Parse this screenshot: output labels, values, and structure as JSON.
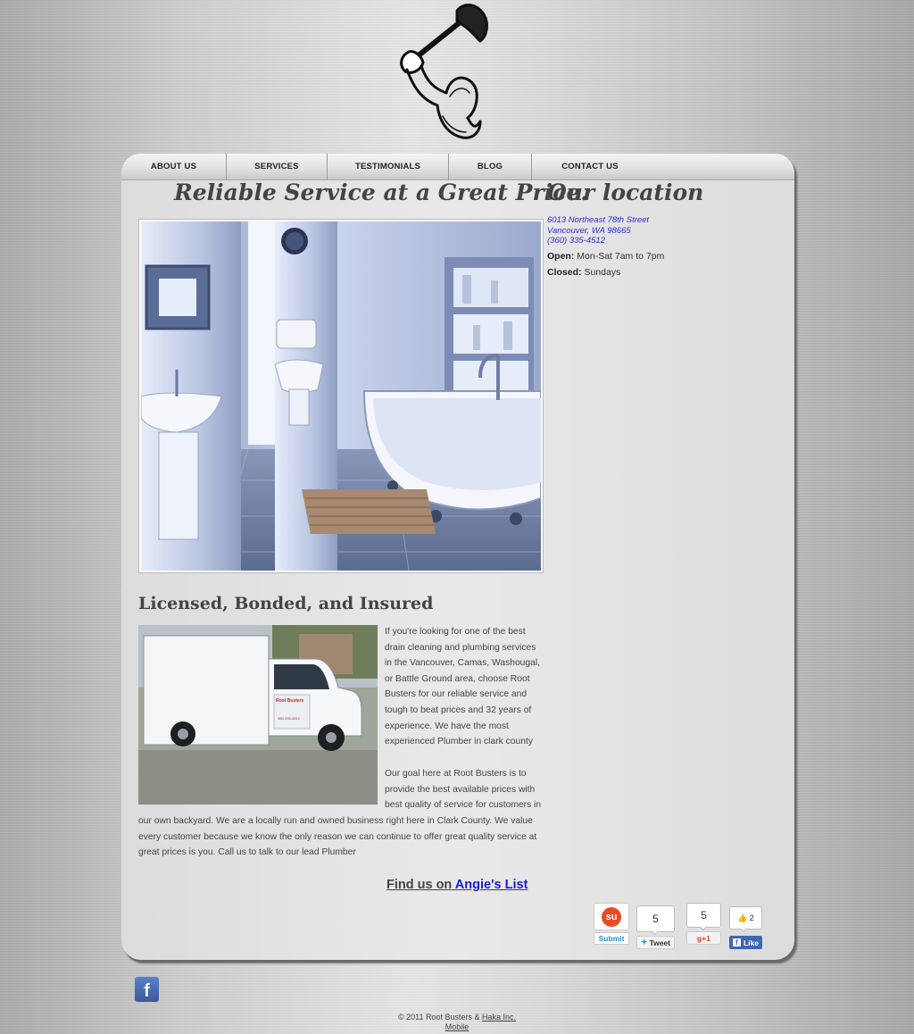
{
  "nav": {
    "items": [
      {
        "label": "ABOUT US"
      },
      {
        "label": "SERVICES"
      },
      {
        "label": "TESTIMONIALS"
      },
      {
        "label": "BLOG"
      },
      {
        "label": "CONTACT US"
      }
    ]
  },
  "main": {
    "heading": "Reliable Service at a Great Price.",
    "subheading": "Licensed, Bonded, and Insured",
    "paragraph1": "If you're looking for one of the best drain cleaning and plumbing services in the Vancouver, Camas, Washougal, or Battle Ground area, choose Root Busters for our reliable service and tough to beat prices and 32 years of experience. We have the most experienced Plumber in clark county",
    "paragraph2_part1": "Our goal here at Root Busters is to provide the best available prices with best quality of service for customers in",
    "paragraph2_part2": "our own backyard. We are a locally run and owned business right here in Clark County. We value every customer because we know the only reason we can continue to offer great quality service at great prices is you. Call us to talk to our lead Plumber",
    "find_us_prefix": "Find us on",
    "find_us_link": "Angie's List",
    "truck_text": {
      "line1": "Root Busters",
      "line2": "360-335-4512"
    }
  },
  "location": {
    "heading": "Our location",
    "street": "6013 Northeast 78th Street",
    "city": "Vancouver, WA 98665",
    "phone": "(360) 335-4512",
    "open_label": "Open:",
    "open_value": "Mon-Sat 7am to 7pm",
    "closed_label": "Closed:",
    "closed_value": "Sundays"
  },
  "social": {
    "stumble_label": "Submit",
    "tweet_count": "5",
    "tweet_label": "Tweet",
    "gplus_count": "5",
    "gplus_label": "g+1",
    "fb_count": "2",
    "fb_label": "Like"
  },
  "footer": {
    "copyright": "© 2011 Root Busters &",
    "credit_link": "Haka Inc.",
    "mobile_link": "Mobile"
  },
  "colors": {
    "link_blue": "#1a1ae0",
    "address_blue": "#2b2bd8",
    "facebook_blue": "#3b5998"
  },
  "icons": [
    "plunger-arm-logo-icon",
    "stumbleupon-icon",
    "twitter-icon",
    "google-plus-icon",
    "facebook-like-icon",
    "facebook-icon"
  ]
}
